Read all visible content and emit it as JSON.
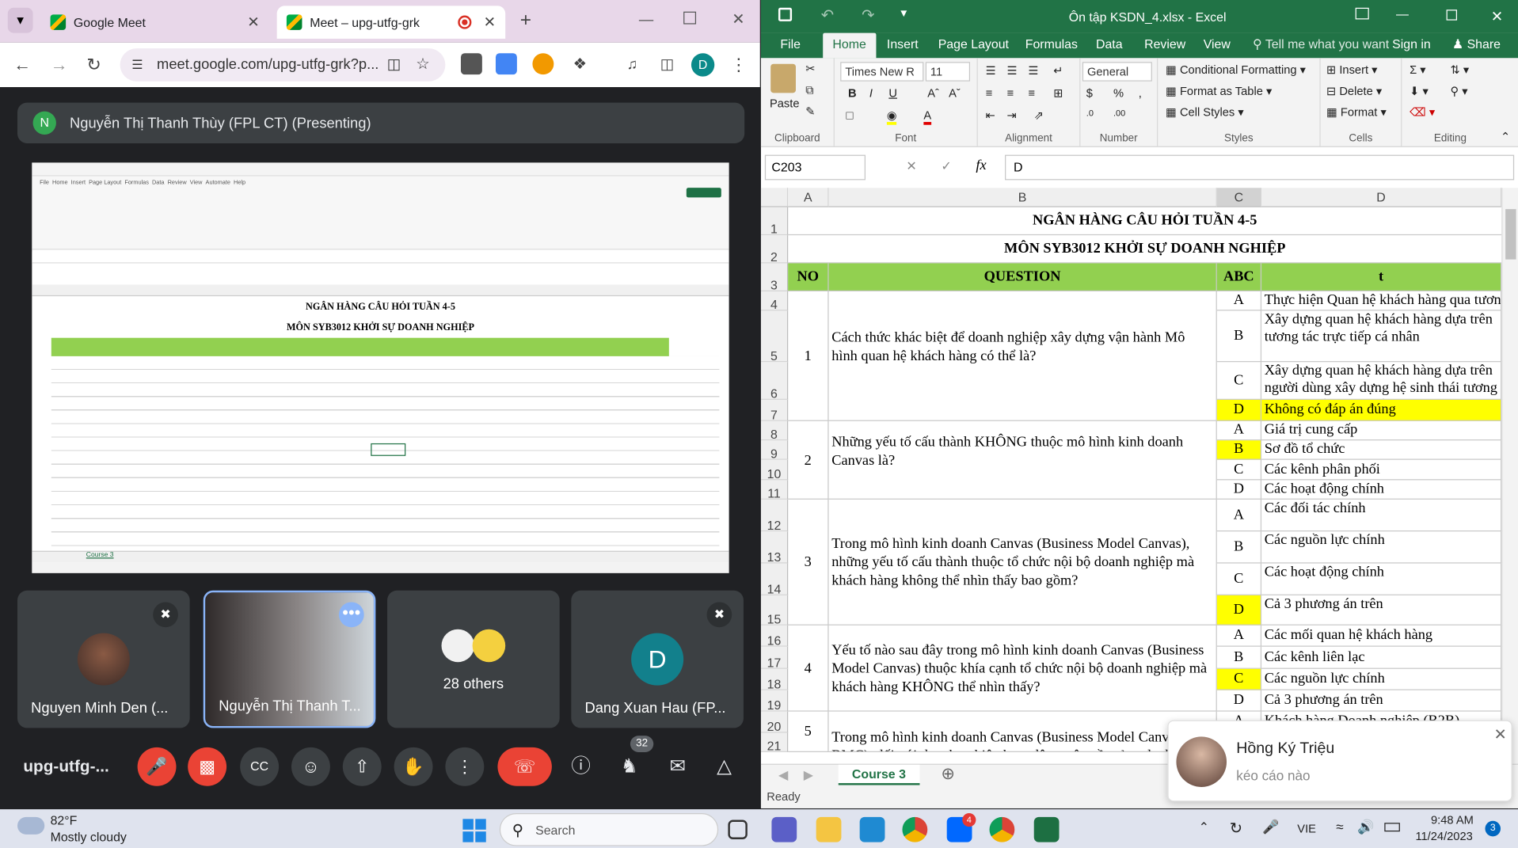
{
  "chrome": {
    "tabs": [
      {
        "label": "Google Meet"
      },
      {
        "label": "Meet – upg-utfg-grk"
      }
    ],
    "url": "meet.google.com/upg-utfg-grk?p...",
    "profile_initial": "D"
  },
  "meet": {
    "presenting_initial": "N",
    "presenting_label": "Nguyễn Thị Thanh Thùy (FPL CT) (Presenting)",
    "participants": [
      {
        "name": "Nguyen Minh Den (..."
      },
      {
        "name": "Nguyễn Thị Thanh T..."
      },
      {
        "name": "28 others"
      },
      {
        "name": "Dang Xuan Hau (FP...",
        "initial": "D"
      }
    ],
    "meeting_code": "upg-utfg-...",
    "people_count": "32",
    "shared_screen": {
      "title": "NGÂN HÀNG CÂU HỎI TUẦN 4-5",
      "subtitle": "MÔN SYB3012 KHỞI SỰ DOANH NGHIỆP",
      "sheet_tab": "Course 3"
    }
  },
  "excel": {
    "title": "Ôn tập KSDN_4.xlsx - Excel",
    "tabs": [
      "File",
      "Home",
      "Insert",
      "Page Layout",
      "Formulas",
      "Data",
      "Review",
      "View"
    ],
    "tell_me": "Tell me what you want to",
    "sign_in": "Sign in",
    "share": "Share",
    "ribbon": {
      "paste": "Paste",
      "clipboard": "Clipboard",
      "font_name": "Times New R",
      "font_size": "11",
      "font": "Font",
      "alignment": "Alignment",
      "number_format": "General",
      "number": "Number",
      "conditional_formatting": "Conditional Formatting",
      "format_as_table": "Format as Table",
      "cell_styles": "Cell Styles",
      "styles": "Styles",
      "insert": "Insert",
      "delete": "Delete",
      "format": "Format",
      "cells": "Cells",
      "editing": "Editing"
    },
    "name_box": "C203",
    "formula": "D",
    "columns": [
      "A",
      "B",
      "C",
      "D"
    ],
    "sheet": {
      "title": "NGÂN HÀNG CÂU HỎI TUẦN 4-5",
      "subtitle": "MÔN SYB3012 KHỞI SỰ DOANH NGHIỆP",
      "headers": [
        "NO",
        "QUESTION",
        "ABC",
        "t"
      ],
      "questions": [
        {
          "no": "1",
          "text": "Cách thức khác biệt để doanh nghiệp xây dựng vận hành Mô hình quan hệ khách hàng có thể là?"
        },
        {
          "no": "2",
          "text": "Những yếu tố cấu thành KHÔNG thuộc mô hình kinh doanh Canvas là?"
        },
        {
          "no": "3",
          "text": "Trong mô hình kinh doanh Canvas (Business Model Canvas), những yếu tố cấu thành thuộc tổ chức nội bộ doanh nghiệp mà khách hàng không thể nhìn thấy bao gồm?"
        },
        {
          "no": "4",
          "text": " Yếu tố nào sau đây trong mô hình kinh doanh Canvas (Business Model Canvas) thuộc khía cạnh tổ chức nội bộ doanh nghiệp mà khách hàng KHÔNG thể nhìn thấy?"
        },
        {
          "no": "5",
          "text": " Trong mô hình kinh doanh Canvas (Business Model Canvas - BMC), đối với doanh nghiệp hoạt động trên nền tảng đa diện"
        }
      ],
      "answers": [
        {
          "row": "4",
          "letter": "A",
          "text": "Thực hiện Quan hệ khách hàng qua tương tác trả lời tự động."
        },
        {
          "row": "5",
          "letter": "B",
          "text": "Xây dựng quan hệ khách hàng dựa trên tương tác trực tiếp cá nhân"
        },
        {
          "row": "6",
          "letter": "C",
          "text": "Xây dựng quan hệ khách hàng dựa trên người dùng xây dựng hệ sinh thái tương tác cộng đồng trên nền tảng đa diện của doanh nghiệp."
        },
        {
          "row": "7",
          "letter": "D",
          "text": "Không có đáp án đúng"
        },
        {
          "row": "8",
          "letter": "A",
          "text": "Giá trị cung cấp"
        },
        {
          "row": "9",
          "letter": "B",
          "text": "Sơ đồ tổ chức"
        },
        {
          "row": "10",
          "letter": "C",
          "text": "Các kênh phân phối"
        },
        {
          "row": "11",
          "letter": "D",
          "text": "Các hoạt động chính"
        },
        {
          "row": "12",
          "letter": "A",
          "text": "Các đối tác chính"
        },
        {
          "row": "13",
          "letter": "B",
          "text": "Các nguồn lực chính"
        },
        {
          "row": "14",
          "letter": "C",
          "text": "Các hoạt động chính"
        },
        {
          "row": "15",
          "letter": "D",
          "text": "Cả 3 phương án trên"
        },
        {
          "row": "16",
          "letter": "A",
          "text": "Các mối quan hệ khách hàng"
        },
        {
          "row": "17",
          "letter": "B",
          "text": "Các kênh liên lạc"
        },
        {
          "row": "18",
          "letter": "C",
          "text": "Các nguồn lực chính"
        },
        {
          "row": "19",
          "letter": "D",
          "text": "Cả 3 phương án trên"
        },
        {
          "row": "20",
          "letter": "A",
          "text": "Khách hàng Doanh nghiệp (B2B)"
        }
      ],
      "extra_rows": [
        "1",
        "2",
        "3",
        "21"
      ]
    },
    "sheet_tab": "Course 3",
    "status": "Ready"
  },
  "toast": {
    "name": "Hồng Ký Triệu",
    "message": "kéo cáo nào"
  },
  "taskbar": {
    "temp": "82°F",
    "weather": "Mostly cloudy",
    "search": "Search",
    "zalo_badge": "4",
    "lang": "VIE",
    "time": "9:48 AM",
    "date": "11/24/2023",
    "notif_count": "3"
  }
}
